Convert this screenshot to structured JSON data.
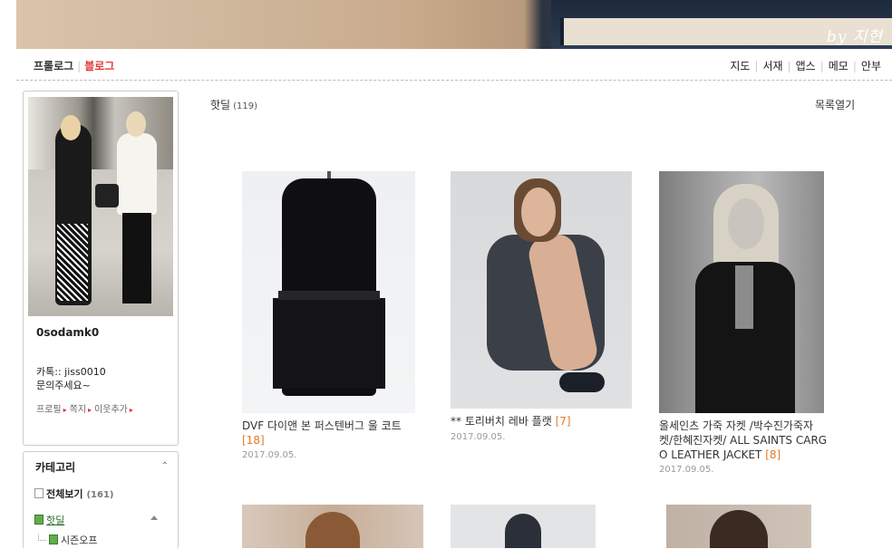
{
  "banner": {
    "signature": "by 지현"
  },
  "topnav": {
    "left": [
      {
        "label": "프롤로그"
      },
      {
        "label": "블로그"
      }
    ],
    "right": [
      {
        "label": "지도"
      },
      {
        "label": "서재"
      },
      {
        "label": "앱스"
      },
      {
        "label": "메모"
      },
      {
        "label": "안부"
      }
    ]
  },
  "profile": {
    "name": "0sodamk0",
    "description_line1": "카톡:: jiss0010",
    "description_line2": "문의주세요~",
    "links": [
      "프로필",
      "쪽지",
      "이웃추가"
    ]
  },
  "category": {
    "title": "카테고리",
    "items": [
      {
        "label": "전체보기",
        "count": "(161)"
      },
      {
        "label": "핫딜"
      },
      {
        "label": "시즌오프"
      }
    ]
  },
  "main": {
    "title": "핫딜",
    "count": "(119)",
    "list_toggle": "목록열기",
    "posts": [
      {
        "title": "DVF 다이앤 본 퍼스텐버그 울 코트",
        "comments": "[18]",
        "date": "2017.09.05."
      },
      {
        "title": "** 토리버치 레바 플랫",
        "comments": "[7]",
        "date": "2017.09.05."
      },
      {
        "title_line1": "올세인츠 가죽 자켓 /박수진가죽자",
        "title_line2": "켓/한혜진자켓/ ALL SAINTS CARG",
        "title_line3": "O LEATHER JACKET",
        "comments": "[8]",
        "date": "2017.09.05."
      }
    ]
  },
  "colors": {
    "accent_red": "#e23a3a",
    "comment_orange": "#e07a2a",
    "category_green": "#2b6a2b"
  }
}
